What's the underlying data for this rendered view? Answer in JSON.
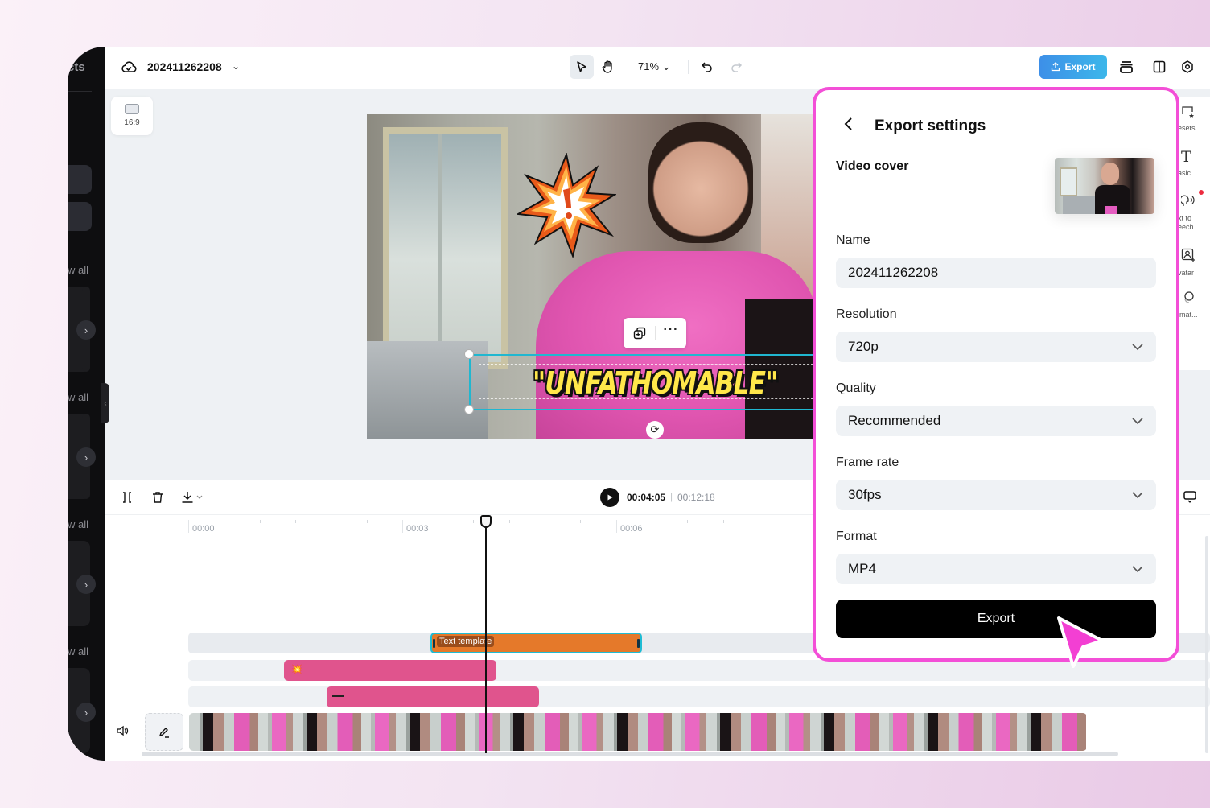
{
  "app": {
    "project_name": "202411262208",
    "aspect_ratio": "16:9",
    "zoom_level": "71%",
    "export_button": "Export",
    "accent_color": "#3d8fe8",
    "highlight_color": "#f34fd7"
  },
  "left_sidebar": {
    "header_fragment": "cts",
    "view_all_labels": [
      "w all",
      "w all",
      "w all",
      "w all"
    ]
  },
  "right_rail": {
    "items": [
      {
        "label": "esets",
        "icon": "presets-icon"
      },
      {
        "label": "asic",
        "icon": "text-basic-icon"
      },
      {
        "label": "xt to eech",
        "icon": "text-to-speech-icon",
        "badge": true
      },
      {
        "label": "vatar",
        "icon": "avatar-icon"
      },
      {
        "label": "imat...",
        "icon": "animation-icon"
      }
    ]
  },
  "canvas": {
    "overlay_text": "\"UNFATHOMABLE\""
  },
  "timeline": {
    "current_time": "00:04:05",
    "total_time": "00:12:18",
    "ruler_labels": [
      "00:00",
      "00:03",
      "00:06"
    ],
    "text_clip_label": "Text template"
  },
  "export_panel": {
    "title": "Export settings",
    "video_cover_label": "Video cover",
    "fields": [
      {
        "label": "Name",
        "value": "202411262208",
        "type": "text"
      },
      {
        "label": "Resolution",
        "value": "720p",
        "type": "select"
      },
      {
        "label": "Quality",
        "value": "Recommended",
        "type": "select"
      },
      {
        "label": "Frame rate",
        "value": "30fps",
        "type": "select"
      },
      {
        "label": "Format",
        "value": "MP4",
        "type": "select"
      }
    ],
    "export_button": "Export"
  }
}
